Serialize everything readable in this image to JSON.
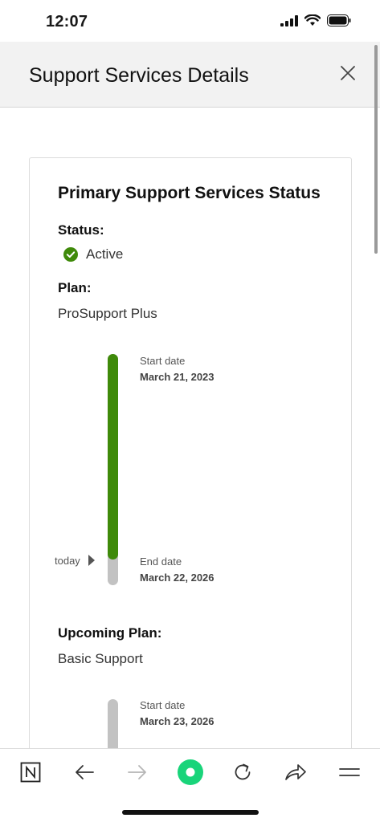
{
  "status_bar": {
    "time": "12:07"
  },
  "header": {
    "title": "Support Services Details"
  },
  "card": {
    "title": "Primary Support Services Status",
    "status_label": "Status:",
    "status_value": "Active",
    "plan_label": "Plan:",
    "plan_value": "ProSupport Plus",
    "timeline": {
      "start_label": "Start date",
      "start_date": "March 21, 2023",
      "end_label": "End date",
      "end_date": "March 22, 2026",
      "today_label": "today",
      "elapsed_fraction": 0.89
    },
    "upcoming_label": "Upcoming Plan:",
    "upcoming_value": "Basic Support",
    "upcoming_timeline": {
      "start_label": "Start date",
      "start_date": "March 23, 2026"
    }
  },
  "colors": {
    "active_green": "#3f8a0a",
    "track_gray": "#c2c2c2",
    "brand_green": "#19d47a"
  },
  "icons": [
    "signal-icon",
    "wifi-icon",
    "battery-icon",
    "close-icon",
    "check-circle-icon",
    "app-logo-icon",
    "back-arrow-icon",
    "forward-arrow-icon",
    "home-dot-icon",
    "reload-icon",
    "share-icon",
    "menu-icon"
  ]
}
